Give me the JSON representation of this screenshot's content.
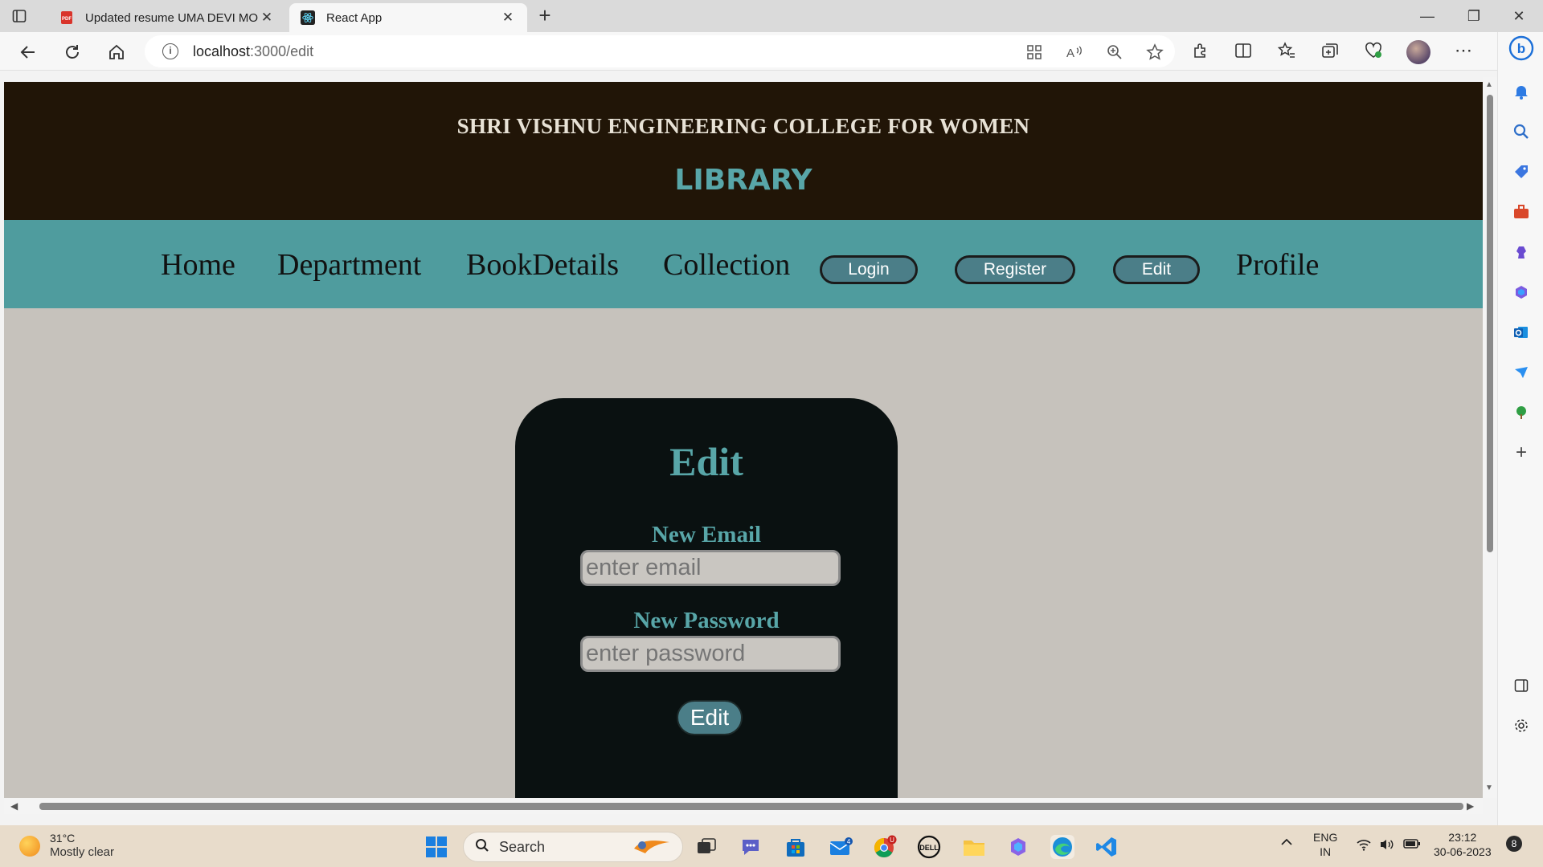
{
  "browser": {
    "tabs": [
      {
        "title": "Updated resume UMA DEVI MOHANTY",
        "favicon": "pdf-icon",
        "active": false
      },
      {
        "title": "React App",
        "favicon": "react-icon",
        "active": true
      }
    ],
    "url": {
      "host": "localhost",
      "path": ":3000/edit"
    }
  },
  "page": {
    "college_name": "SHRI VISHNU ENGINEERING COLLEGE FOR WOMEN",
    "library_title": "LIBRARY",
    "nav": {
      "home": "Home",
      "department": "Department",
      "book_details": "BookDetails",
      "collection": "Collection",
      "login": "Login",
      "register": "Register",
      "edit": "Edit",
      "profile": "Profile"
    },
    "form": {
      "title": "Edit",
      "email_label": "New Email",
      "email_placeholder": "enter email",
      "password_label": "New Password",
      "password_placeholder": "enter password",
      "submit_label": "Edit"
    }
  },
  "taskbar": {
    "weather": {
      "temp": "31°C",
      "desc": "Mostly clear"
    },
    "search_label": "Search",
    "mail_badge": "4",
    "chrome_badge": "U",
    "lang": {
      "line1": "ENG",
      "line2": "IN"
    },
    "clock": {
      "time": "23:12",
      "date": "30-06-2023"
    },
    "notification_count": "8"
  },
  "colors": {
    "header_bg": "#211507",
    "accent_teal": "#58a6a8",
    "nav_bg": "#4f9c9e",
    "page_bg": "#c6c2bc",
    "card_bg": "#0a1111"
  }
}
